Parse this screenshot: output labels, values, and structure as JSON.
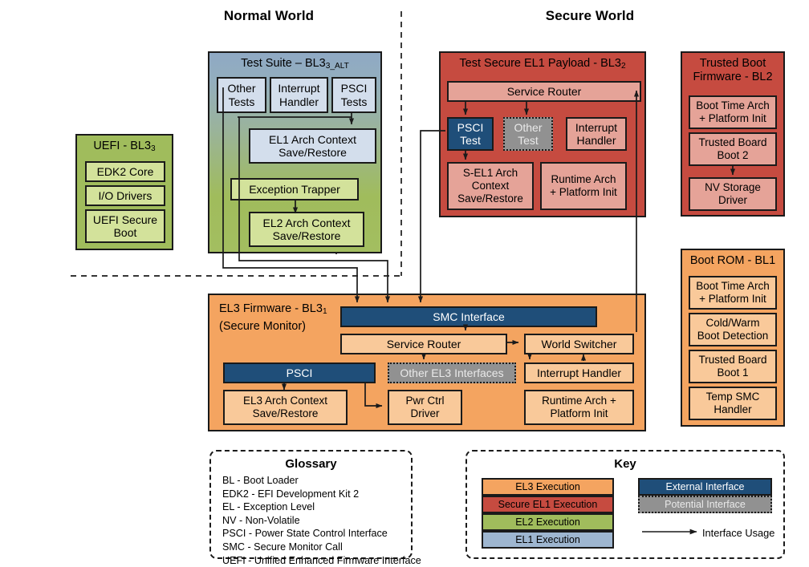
{
  "worlds": {
    "normal": "Normal World",
    "secure": "Secure World"
  },
  "uefi": {
    "title": "UEFI - BL3",
    "title_sub": "3",
    "items": [
      {
        "label": "EDK2 Core"
      },
      {
        "label": "I/O Drivers"
      },
      {
        "label": "UEFI Secure\nBoot"
      }
    ]
  },
  "test_suite": {
    "title": "Test Suite – BL3",
    "title_sub": "3_ALT",
    "tests": [
      {
        "label": "Other\nTests"
      },
      {
        "label": "Interrupt\nHandler"
      },
      {
        "label": "PSCI\nTests"
      }
    ],
    "el1_ctx": "EL1 Arch Context\nSave/Restore",
    "exception_trapper": "Exception Trapper",
    "el2_ctx": "EL2 Arch Context\nSave/Restore"
  },
  "secure_payload": {
    "title": "Test Secure EL1 Payload - BL3",
    "title_sub": "2",
    "service_router": "Service Router",
    "psci_test": "PSCI\nTest",
    "other_test": "Other\nTest",
    "interrupt_handler": "Interrupt\nHandler",
    "sel1_ctx": "S-EL1 Arch\nContext\nSave/Restore",
    "runtime_init": "Runtime Arch\n+ Platform Init"
  },
  "trusted_boot_fw": {
    "title": "Trusted Boot\nFirmware - BL2",
    "items": [
      {
        "label": "Boot Time Arch\n+ Platform Init"
      },
      {
        "label": "Trusted Board\nBoot 2"
      },
      {
        "label": "NV Storage\nDriver"
      }
    ]
  },
  "boot_rom": {
    "title": "Boot ROM - BL1",
    "items": [
      {
        "label": "Boot Time Arch\n+ Platform Init"
      },
      {
        "label": "Cold/Warm\nBoot Detection"
      },
      {
        "label": "Trusted Board\nBoot 1"
      },
      {
        "label": "Temp SMC\nHandler"
      }
    ]
  },
  "el3_firmware": {
    "title_line1": "EL3 Firmware - BL3",
    "title_sub": "1",
    "title_line2": "(Secure Monitor)",
    "smc_interface": "SMC Interface",
    "service_router": "Service Router",
    "world_switcher": "World Switcher",
    "psci": "PSCI",
    "other_el3": "Other EL3 Interfaces",
    "interrupt_handler": "Interrupt Handler",
    "el3_ctx": "EL3 Arch Context\nSave/Restore",
    "pwr_ctrl": "Pwr Ctrl\nDriver",
    "runtime_init": "Runtime Arch +\nPlatform Init"
  },
  "glossary": {
    "title": "Glossary",
    "entries": [
      "BL - Boot Loader",
      "EDK2 - EFI Development Kit 2",
      "EL - Exception Level",
      "NV - Non-Volatile",
      "PSCI - Power State Control Interface",
      "SMC - Secure Monitor Call",
      "UEFI - Unified Enhanced Firmware Interface"
    ]
  },
  "key": {
    "title": "Key",
    "execution": [
      {
        "label": "EL3 Execution",
        "color": "#F4A460"
      },
      {
        "label": "Secure EL1 Execution",
        "color": "#C64B40"
      },
      {
        "label": "EL2 Execution",
        "color": "#A0BC5C"
      },
      {
        "label": "EL1 Execution",
        "color": "#9EB6D0"
      }
    ],
    "interfaces": [
      {
        "label": "External Interface",
        "color": "#1F4E79"
      },
      {
        "label": "Potential Interface",
        "color": "#919191"
      }
    ],
    "arrow_label": "Interface Usage"
  },
  "colors": {
    "el3": "#F4A460",
    "el3_lite": "#F9C99A",
    "secure_el1": "#C64B40",
    "secure_el1_lite": "#E5A398",
    "el2": "#A0BC5C",
    "el2_lite": "#D3E29B",
    "el1": "#9EB6D0",
    "el1_lite": "#D3DEEC",
    "external_interface": "#1F4E79",
    "potential_interface": "#919191",
    "outline": "#1A1A1A"
  }
}
